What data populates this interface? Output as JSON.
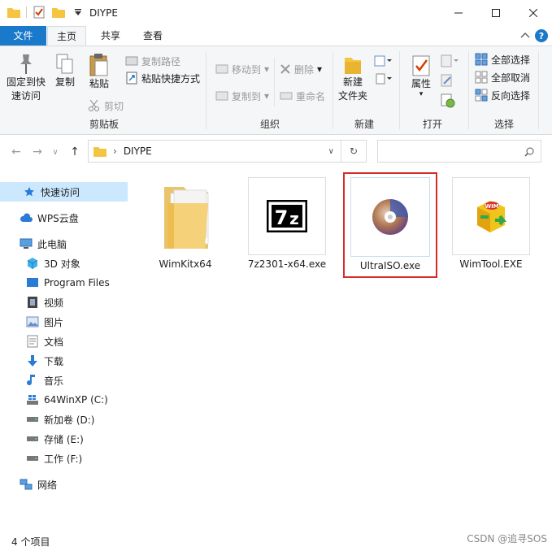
{
  "window": {
    "title": "DIYPE",
    "minimize_icon": "minimize-icon",
    "maximize_icon": "maximize-icon",
    "close_icon": "close-icon"
  },
  "tabs": {
    "file": "文件",
    "home": "主页",
    "share": "共享",
    "view": "查看"
  },
  "ribbon": {
    "clipboard": {
      "label": "剪贴板",
      "pin": "固定到快速访问",
      "pin_line1": "固定到快",
      "pin_line2": "速访问",
      "copy": "复制",
      "paste": "粘贴",
      "copy_path": "复制路径",
      "paste_shortcut": "粘贴快捷方式",
      "cut": "剪切"
    },
    "organize": {
      "label": "组织",
      "move_to": "移动到",
      "copy_to": "复制到",
      "delete": "删除",
      "rename": "重命名"
    },
    "new": {
      "label": "新建",
      "new_folder_line1": "新建",
      "new_folder_line2": "文件夹"
    },
    "open": {
      "label": "打开",
      "properties": "属性"
    },
    "select": {
      "label": "选择",
      "select_all": "全部选择",
      "select_none": "全部取消",
      "invert": "反向选择"
    }
  },
  "address": {
    "path": "DIYPE",
    "search_placeholder": ""
  },
  "nav": {
    "quick_access": "快速访问",
    "wps": "WPS云盘",
    "this_pc": "此电脑",
    "objects3d": "3D 对象",
    "program_files": "Program Files",
    "videos": "视频",
    "pictures": "图片",
    "documents": "文档",
    "downloads": "下载",
    "music": "音乐",
    "drive_c": "64WinXP  (C:)",
    "drive_d": "新加卷 (D:)",
    "drive_e": "存储 (E:)",
    "drive_f": "工作 (F:)",
    "network": "网络"
  },
  "files": [
    {
      "name": "WimKitx64",
      "icon": "folder-icon"
    },
    {
      "name": "7z2301-x64.exe",
      "icon": "7zip-icon"
    },
    {
      "name": "UltraISO.exe",
      "icon": "ultraiso-disc-icon"
    },
    {
      "name": "WimTool.EXE",
      "icon": "wimtool-icon"
    }
  ],
  "status": {
    "count": "4 个项目"
  },
  "watermark": "CSDN @追寻SOS",
  "colors": {
    "accent": "#1979ca",
    "highlight_border": "#d52b2b",
    "selection": "#cce8ff"
  }
}
